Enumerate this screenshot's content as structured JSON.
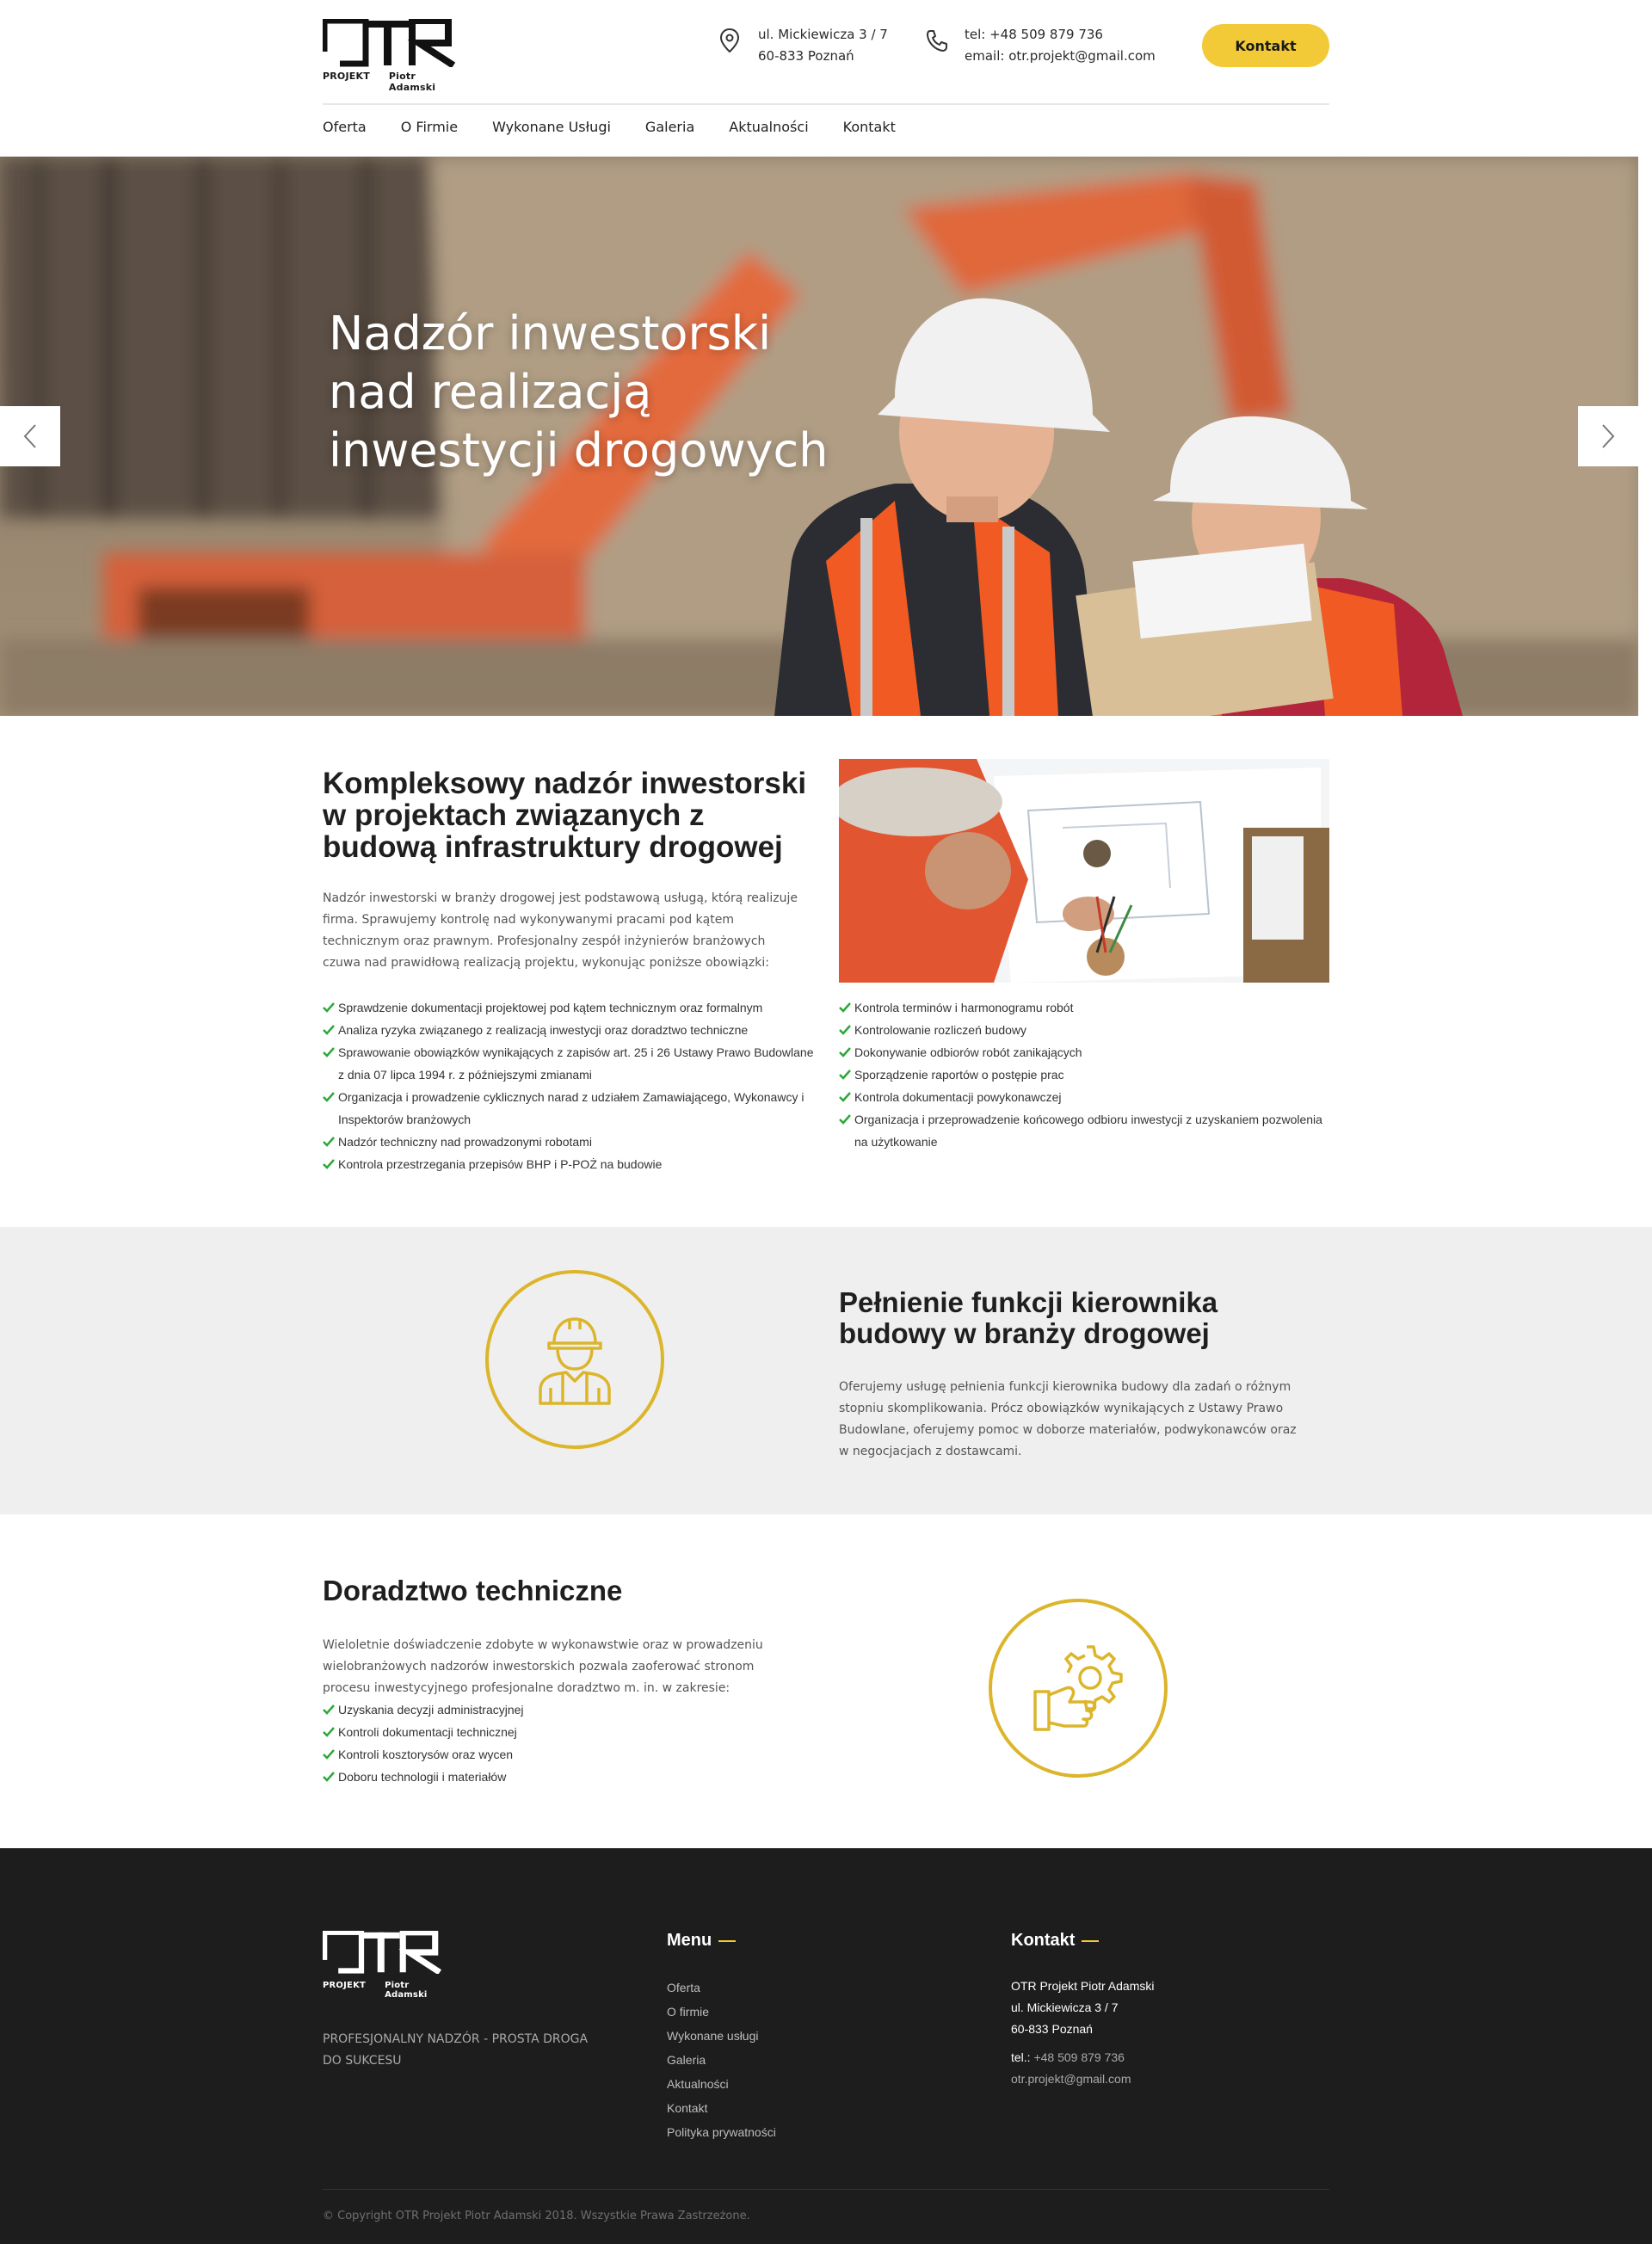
{
  "brand": {
    "logo_text": "OTR",
    "logo_sub_left": "PROJEKT",
    "logo_sub_right": "Piotr Adamski",
    "accent_color": "#f2c936",
    "icon_color": "#dcb52b"
  },
  "header": {
    "address_line1": "ul. Mickiewicza 3 / 7",
    "address_line2": "60-833 Poznań",
    "phone_line": "tel: +48 509 879 736",
    "email_line": "email: otr.projekt@gmail.com",
    "contact_button": "Kontakt",
    "address_icon": "location-pin-icon",
    "phone_icon": "phone-icon"
  },
  "nav": {
    "items": [
      "Oferta",
      "O Firmie",
      "Wykonane Usługi",
      "Galeria",
      "Aktualności",
      "Kontakt"
    ]
  },
  "hero": {
    "title": "Nadzór inwestorski nad realizacją inwestycji drogowych",
    "prev_icon": "chevron-left-icon",
    "next_icon": "chevron-right-icon"
  },
  "section1": {
    "heading": "Kompleksowy nadzór inwestorski w projektach związanych z budową infrastruktury drogowej",
    "intro": "Nadzór inwestorski w branży drogowej jest podstawową usługą, którą realizuje firma. Sprawujemy kontrolę nad wykonywanymi pracami pod kątem technicznym oraz prawnym. Profesjonalny zespół inżynierów branżowych czuwa nad prawidłową realizacją projektu, wykonując poniższe obowiązki:",
    "list_left": [
      "Sprawdzenie dokumentacji projektowej pod kątem technicznym oraz formalnym",
      "Analiza ryzyka związanego z realizacją inwestycji oraz doradztwo techniczne",
      "Sprawowanie obowiązków wynikających z zapisów art. 25 i 26 Ustawy Prawo Budowlane z dnia 07 lipca 1994 r. z późniejszymi zmianami",
      "Organizacja i prowadzenie cyklicznych narad z udziałem Zamawiającego, Wykonawcy i Inspektorów branżowych",
      "Nadzór techniczny nad prowadzonymi robotami",
      "Kontrola przestrzegania przepisów BHP i P-POŻ na budowie"
    ],
    "list_right": [
      "Kontrola terminów i harmonogramu robót",
      "Kontrolowanie rozliczeń budowy",
      "Dokonywanie odbiorów robót zanikających",
      "Sporządzenie raportów o postępie prac",
      "Kontrola dokumentacji powykonawczej",
      "Organizacja i przeprowadzenie końcowego odbioru inwestycji z uzyskaniem pozwolenia na użytkowanie"
    ]
  },
  "section2": {
    "heading": "Pełnienie funkcji kierownika budowy w branży drogowej",
    "text": "Oferujemy usługę pełnienia funkcji kierownika budowy dla zadań o różnym stopniu skomplikowania. Prócz obowiązków wynikających z Ustawy Prawo Budowlane, oferujemy pomoc w doborze materiałów, podwykonawców oraz w negocjacjach z dostawcami.",
    "icon": "construction-worker-icon"
  },
  "section3": {
    "heading": "Doradztwo techniczne",
    "text": "Wieloletnie doświadczenie zdobyte w wykonawstwie oraz w prowadzeniu wielobranżowych nadzorów inwestorskich pozwala zaoferować stronom procesu inwestycyjnego profesjonalne doradztwo m. in. w zakresie:",
    "list": [
      "Uzyskania decyzji administracyjnej",
      "Kontroli dokumentacji technicznej",
      "Kontroli kosztorysów oraz wycen",
      "Doboru technologii i materiałów"
    ],
    "icon": "gear-hand-icon"
  },
  "footer": {
    "tagline": "PROFESJONALNY NADZÓR - PROSTA DROGA DO SUKCESU",
    "menu_title": "Menu",
    "menu_items": [
      "Oferta",
      "O firmie",
      "Wykonane usługi",
      "Galeria",
      "Aktualności",
      "Kontakt",
      "Polityka prywatności"
    ],
    "contact_title": "Kontakt",
    "contact_company": "OTR Projekt Piotr Adamski",
    "contact_street": "ul. Mickiewicza 3 / 7",
    "contact_city": "60-833 Poznań",
    "contact_tel_label": "tel.:",
    "contact_tel_value": "+48 509 879 736",
    "contact_email": "otr.projekt@gmail.com",
    "copyright": "© Copyright OTR Projekt Piotr Adamski 2018. Wszystkie Prawa Zastrzeżone."
  }
}
